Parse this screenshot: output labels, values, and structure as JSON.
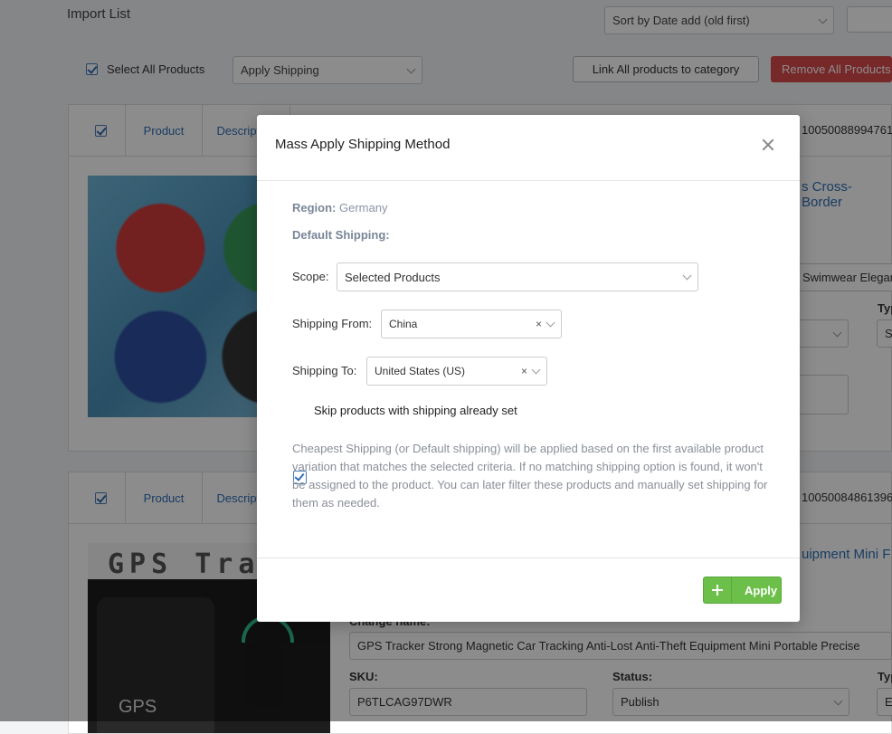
{
  "page": {
    "title": "Import List",
    "sort_select": "Sort by Date add (old first)",
    "select_all_label": "Select All Products",
    "apply_shipping_select": "Apply Shipping",
    "link_all_button": "Link All products to category",
    "remove_all_button": "Remove All Products"
  },
  "cards": [
    {
      "tabs": [
        "Product",
        "Description"
      ],
      "id_partial": "1005008899476129",
      "title_partial": "s Cross-Border",
      "name_partial": "r Swimwear Elegant",
      "type_label": "Typ",
      "type_value": "S"
    },
    {
      "tabs": [
        "Product",
        "Description"
      ],
      "id_partial": "1005008486139655",
      "title_partial": "uipment Mini F",
      "image_text": "GPS Trac",
      "image_text2": "GPS",
      "change_name_label": "Change name:",
      "change_name_value": "GPS Tracker Strong Magnetic Car Tracking Anti-Lost Anti-Theft Equipment Mini Portable Precise",
      "sku_label": "SKU:",
      "sku_value": "P6TLCAG97DWR",
      "status_label": "Status:",
      "status_value": "Publish",
      "type_label": "Typ",
      "type_value": "E"
    }
  ],
  "modal": {
    "title": "Mass Apply Shipping Method",
    "region_label": "Region:",
    "region_value": "Germany",
    "default_shipping_label": "Default Shipping:",
    "scope_label": "Scope:",
    "scope_value": "Selected Products",
    "shipping_from_label": "Shipping From:",
    "shipping_from_value": "China",
    "shipping_to_label": "Shipping To:",
    "shipping_to_value": "United States (US)",
    "clear_symbol": "×",
    "skip_label": "Skip products with shipping already set",
    "skip_checked": true,
    "note": "Cheapest Shipping (or Default shipping) will be applied based on the first available product variation that matches the selected criteria. If no matching shipping option is found, it won't be assigned to the product. You can later filter these products and manually set shipping for them as needed.",
    "apply_label": "Apply"
  }
}
